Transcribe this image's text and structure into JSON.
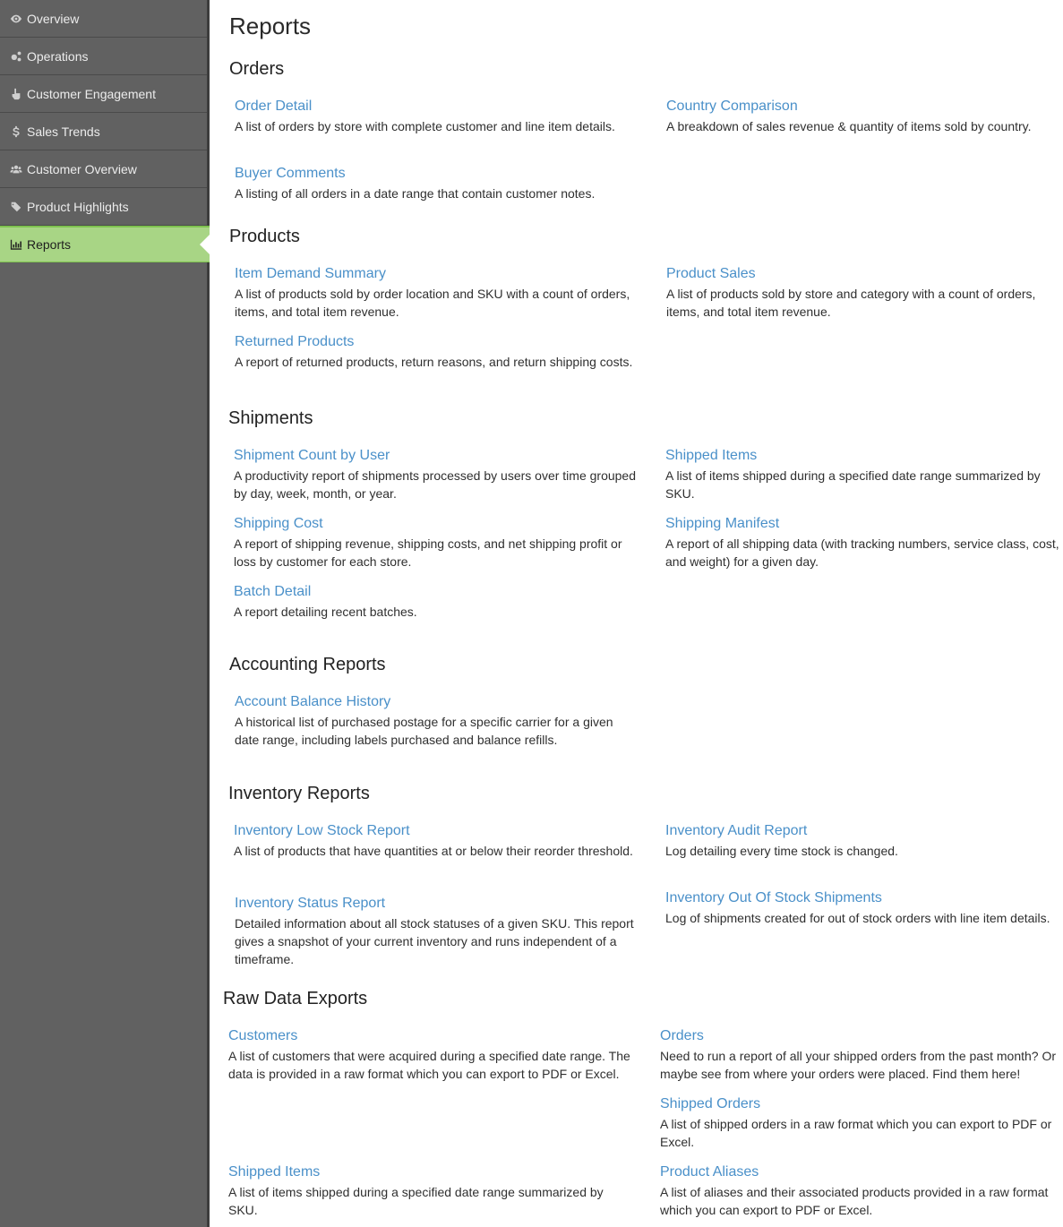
{
  "sidebar": {
    "items": [
      {
        "label": "Overview",
        "icon": "eye-icon"
      },
      {
        "label": "Operations",
        "icon": "gears-icon"
      },
      {
        "label": "Customer Engagement",
        "icon": "pointer-hand-icon"
      },
      {
        "label": "Sales Trends",
        "icon": "dollar-icon"
      },
      {
        "label": "Customer Overview",
        "icon": "users-icon"
      },
      {
        "label": "Product Highlights",
        "icon": "tags-icon"
      },
      {
        "label": "Reports",
        "icon": "bar-chart-icon",
        "active": true
      }
    ],
    "active_color": "#a8d585"
  },
  "page": {
    "title": "Reports"
  },
  "sections": {
    "orders": {
      "title": "Orders",
      "reports": [
        {
          "name": "Order Detail",
          "desc": "A list of orders by store with complete customer and line item details."
        },
        {
          "name": "Country Comparison",
          "desc": "A breakdown of sales revenue & quantity of items sold by country."
        },
        {
          "name": "Buyer Comments",
          "desc": "A listing of all orders in a date range that contain customer notes."
        }
      ]
    },
    "products": {
      "title": "Products",
      "reports": [
        {
          "name": "Item Demand Summary",
          "desc": "A list of products sold by order location and SKU with a count of orders, items, and total item revenue."
        },
        {
          "name": "Product Sales",
          "desc": "A list of products sold by store and category with a count of orders, items, and total item revenue."
        },
        {
          "name": "Returned Products",
          "desc": "A report of returned products, return reasons, and return shipping costs."
        }
      ]
    },
    "shipments": {
      "title": "Shipments",
      "reports": [
        {
          "name": "Shipment Count by User",
          "desc": "A productivity report of shipments processed by users over time grouped by day, week, month, or year."
        },
        {
          "name": "Shipped Items",
          "desc": "A list of items shipped during a specified date range summarized by SKU."
        },
        {
          "name": "Shipping Cost",
          "desc": "A report of shipping revenue, shipping costs, and net shipping profit or loss by customer for each store."
        },
        {
          "name": "Shipping Manifest",
          "desc": "A report of all shipping data (with tracking numbers, service class, cost, and weight) for a given day."
        },
        {
          "name": "Batch Detail",
          "desc": "A report detailing recent batches."
        }
      ]
    },
    "accounting": {
      "title": "Accounting Reports",
      "reports": [
        {
          "name": "Account Balance History",
          "desc": "A historical list of purchased postage for a specific carrier for a given date range, including labels purchased and balance refills."
        }
      ]
    },
    "inventory": {
      "title": "Inventory Reports",
      "reports": [
        {
          "name": "Inventory Low Stock Report",
          "desc": "A list of products that have quantities at or below their reorder threshold."
        },
        {
          "name": "Inventory Audit Report",
          "desc": "Log detailing every time stock is changed."
        },
        {
          "name": "Inventory Status Report",
          "desc": "Detailed information about all stock statuses of a given SKU. This report gives a snapshot of your current inventory and runs independent of a timeframe."
        },
        {
          "name": "Inventory Out Of Stock Shipments",
          "desc": "Log of shipments created for out of stock orders with line item details."
        }
      ]
    },
    "raw": {
      "title": "Raw Data Exports",
      "reports": [
        {
          "name": "Customers",
          "desc": "A list of customers that were acquired during a specified date range. The data is provided in a raw format which you can export to PDF or Excel."
        },
        {
          "name": "Orders",
          "desc": "Need to run a report of all your shipped orders from the past month? Or maybe see from where your orders were placed. Find them here!"
        },
        {
          "name": "Shipped Orders",
          "desc": "A list of shipped orders in a raw format which you can export to PDF or Excel."
        },
        {
          "name": "Shipped Items",
          "desc": "A list of items shipped during a specified date range summarized by SKU."
        },
        {
          "name": "Product Aliases",
          "desc": "A list of aliases and their associated products provided in a raw format which you can export to PDF or Excel."
        }
      ]
    }
  },
  "colors": {
    "link": "#4a90c9",
    "sidebar_bg": "#616161"
  }
}
